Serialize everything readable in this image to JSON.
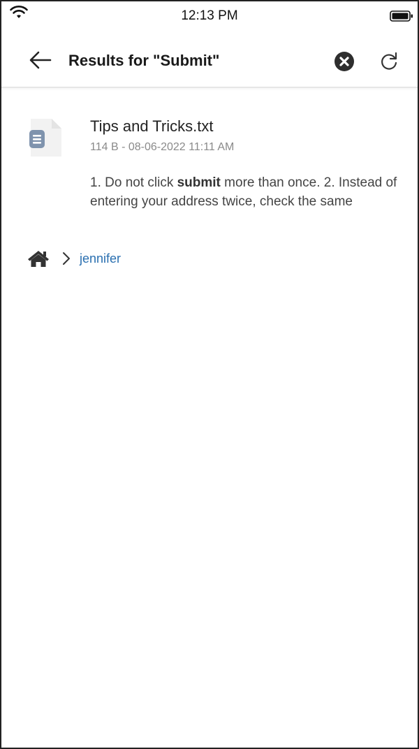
{
  "status_bar": {
    "time": "12:13 PM",
    "icons": [
      "wifi-icon",
      "battery-icon"
    ]
  },
  "header": {
    "title": "Results for \"Submit\"",
    "icons": [
      "back-arrow-icon",
      "clear-search-icon",
      "refresh-icon"
    ]
  },
  "result": {
    "file_icon": "text-file-icon",
    "name": "Tips and Tricks.txt",
    "meta": "114 B - 08-06-2022 11:11 AM",
    "snippet_before": "1. Do not click ",
    "snippet_highlight": "submit",
    "snippet_after": " more than once. 2. Instead of entering your address twice, check the same"
  },
  "breadcrumb": {
    "home_icon": "home-icon",
    "separator_icon": "chevron-right-icon",
    "folder": "jennifer"
  },
  "colors": {
    "link": "#2a6fb0",
    "meta_text": "#8a8a8a",
    "icon_dark": "#333333",
    "file_icon": "#7f93ad"
  }
}
